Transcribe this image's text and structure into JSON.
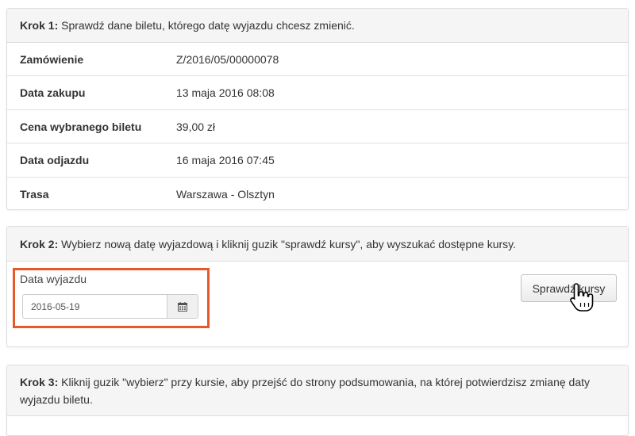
{
  "step1": {
    "title_bold": "Krok 1:",
    "title_text": " Sprawdź dane biletu, którego datę wyjazdu chcesz zmienić.",
    "rows": [
      {
        "label": "Zamówienie",
        "value": "Z/2016/05/00000078"
      },
      {
        "label": "Data zakupu",
        "value": "13 maja 2016 08:08"
      },
      {
        "label": "Cena wybranego biletu",
        "value": "39,00 zł"
      },
      {
        "label": "Data odjazdu",
        "value": "16 maja 2016 07:45"
      },
      {
        "label": "Trasa",
        "value": "Warszawa - Olsztyn"
      }
    ]
  },
  "step2": {
    "title_bold": "Krok 2:",
    "title_text": " Wybierz nową datę wyjazdową i kliknij guzik \"sprawdź kursy\", aby wyszukać dostępne kursy.",
    "date_label": "Data wyjazdu",
    "date_value": "2016-05-19",
    "check_button": "Sprawdź kursy",
    "highlight_color": "#e8592a"
  },
  "step3": {
    "title_bold": "Krok 3:",
    "title_text": " Kliknij guzik \"wybierz\" przy kursie, aby przejść do strony podsumowania, na której potwierdzisz zmianę daty wyjazdu biletu."
  },
  "icons": {
    "calendar": "calendar-icon",
    "cursor": "hand-pointer-icon"
  }
}
